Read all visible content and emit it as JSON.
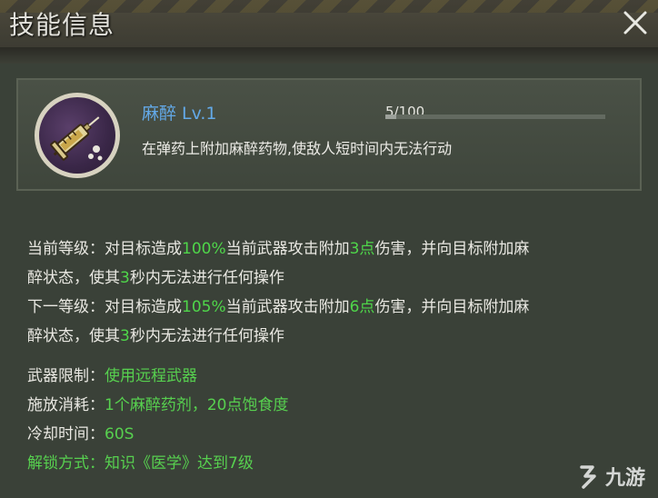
{
  "header": {
    "title": "技能信息",
    "close_icon": "close-icon"
  },
  "skill": {
    "name_level": "麻醉 Lv.1",
    "progress_label": "5/100",
    "progress_value": 5,
    "progress_max": 100,
    "description": "在弹药上附加麻醉药物,使敌人短时间内无法行动",
    "icon": "syringe-icon"
  },
  "current_level": {
    "prefix": "当前等级：对目标造成",
    "percent": "100%",
    "mid": "当前武器攻击附加",
    "points": "3点",
    "suffix": "伤害，并向目标附加麻",
    "line2_prefix": "醉状态，使其",
    "seconds": "3",
    "line2_suffix": "秒内无法进行任何操作"
  },
  "next_level": {
    "prefix": "下一等级：对目标造成",
    "percent": "105%",
    "mid": "当前武器攻击附加",
    "points": "6点",
    "suffix": "伤害，并向目标附加麻",
    "line2_prefix": "醉状态，使其",
    "seconds": "3",
    "line2_suffix": "秒内无法进行任何操作"
  },
  "info": {
    "weapon_label": "武器限制：",
    "weapon_value": "使用远程武器",
    "cost_label": "施放消耗：",
    "cost_value": "1个麻醉药剂，20点饱食度",
    "cooldown_label": "冷却时间：",
    "cooldown_value": "60S",
    "unlock_label": "解锁方式：",
    "unlock_value": "知识《医学》达到7级"
  },
  "watermark": {
    "text": "九游"
  },
  "colors": {
    "highlight": "#4fd64a",
    "skill_name": "#63a9e8"
  }
}
